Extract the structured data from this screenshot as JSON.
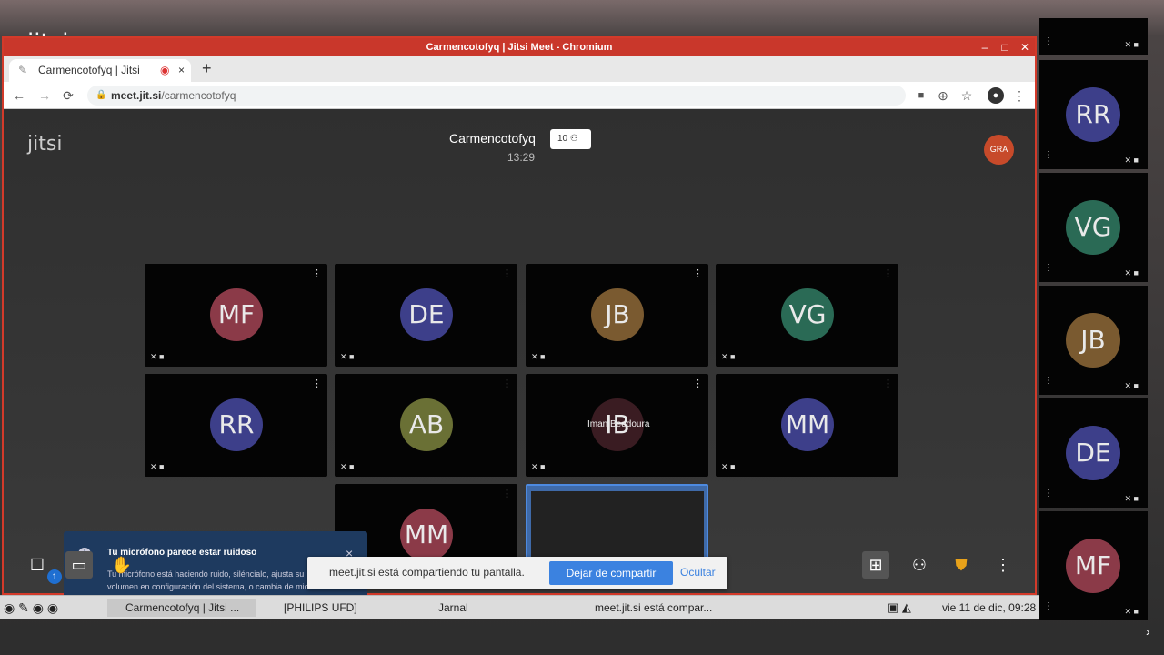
{
  "outer_logo": "jitsi",
  "window": {
    "title": "Carmencotofyq | Jitsi Meet - Chromium",
    "min": "–",
    "max": "□",
    "close": "✕"
  },
  "tab": {
    "label": "Carmencotofyq | Jitsi",
    "close": "×",
    "new": "+"
  },
  "address": {
    "back": "←",
    "forward": "→",
    "reload": "⟳",
    "host": "meet.jit.si",
    "path": "/carmencotofyq"
  },
  "meeting": {
    "logo": "jitsi",
    "title": "Carmencotofyq",
    "time": "13:29",
    "participants": "10",
    "self_initials": "GRA"
  },
  "tiles": [
    {
      "initials": "MF",
      "color": "#8b3a48"
    },
    {
      "initials": "DE",
      "color": "#3d3f8a"
    },
    {
      "initials": "JB",
      "color": "#7a5a30"
    },
    {
      "initials": "VG",
      "color": "#2a6a55"
    },
    {
      "initials": "RR",
      "color": "#3d3f8a"
    },
    {
      "initials": "AB",
      "color": "#6a7035"
    },
    {
      "initials": "IB",
      "color": "#3a1c22",
      "name": "Iman Beddoura"
    },
    {
      "initials": "MM",
      "color": "#3d3f8a"
    },
    {
      "initials": "MM",
      "color": "#8b3a48"
    }
  ],
  "notification": {
    "title": "Tu micrófono parece estar ruidoso",
    "body": "Tu micrófono está haciendo ruido, siléncialo, ajusta su volumen en configuración del sistema, o cambia de micrófono.",
    "close": "×",
    "icon": "info-icon"
  },
  "toolbar": {
    "chat_badge": "1"
  },
  "sharebar": {
    "message": "meet.jit.si está compartiendo tu pantalla.",
    "stop": "Dejar de compartir",
    "hide": "Ocultar"
  },
  "taskbar": {
    "items": [
      "Carmencotofyq | Jitsi ...",
      "[PHILIPS UFD]",
      "Jarnal",
      "meet.jit.si está compar..."
    ],
    "clock": "vie 11 de dic, 09:28"
  },
  "filmstrip": [
    {
      "initials": "RR",
      "color": "#3d3f8a"
    },
    {
      "initials": "VG",
      "color": "#2a6a55"
    },
    {
      "initials": "JB",
      "color": "#7a5a30"
    },
    {
      "initials": "DE",
      "color": "#3d3f8a"
    },
    {
      "initials": "MF",
      "color": "#8b3a48"
    }
  ]
}
